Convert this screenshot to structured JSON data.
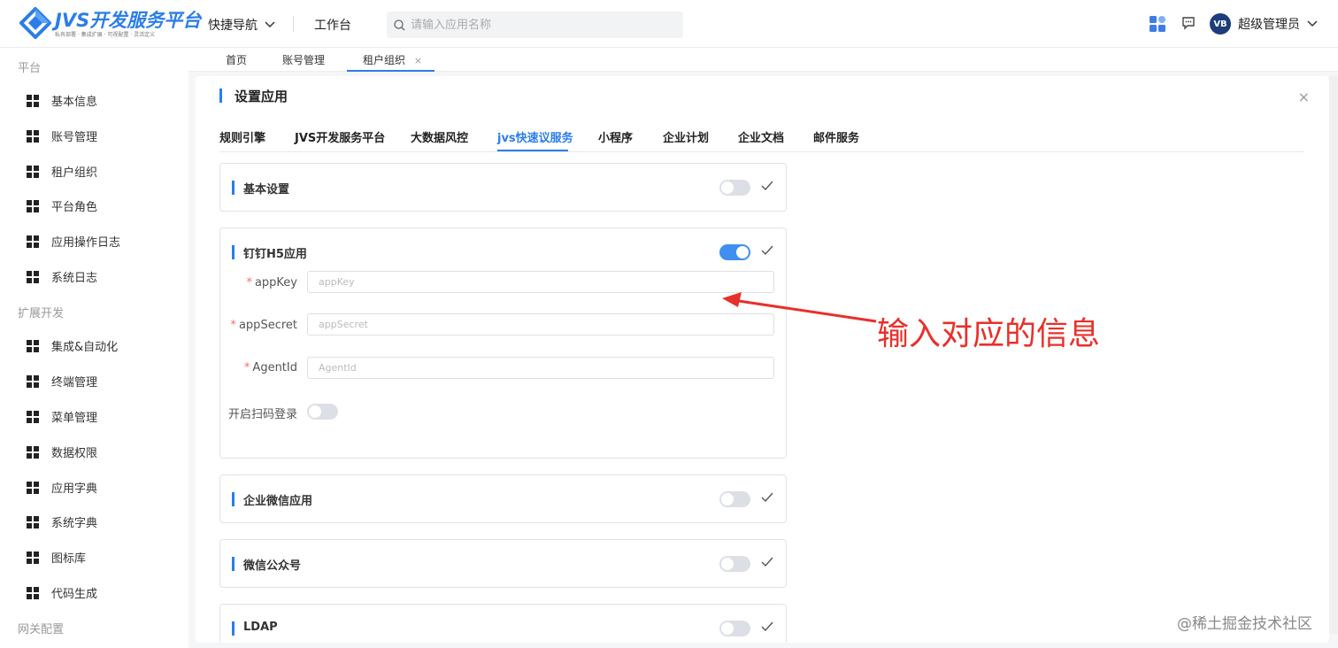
{
  "header": {
    "logo_title": "JVS开发服务平台",
    "logo_subtitle": "私有部署 · 集成扩展 · 可视配置 · 灵活定义",
    "quick_nav": "快捷导航",
    "workbench": "工作台",
    "search_placeholder": "请输入应用名称",
    "avatar_text": "VB",
    "user_name": "超级管理员"
  },
  "sidebar": {
    "group_platform": "平台",
    "group_extend": "扩展开发",
    "group_gateway": "网关配置",
    "items": [
      {
        "label": "基本信息"
      },
      {
        "label": "账号管理"
      },
      {
        "label": "租户组织"
      },
      {
        "label": "平台角色"
      },
      {
        "label": "应用操作日志"
      },
      {
        "label": "系统日志"
      },
      {
        "label": "集成&自动化"
      },
      {
        "label": "终端管理"
      },
      {
        "label": "菜单管理"
      },
      {
        "label": "数据权限"
      },
      {
        "label": "应用字典"
      },
      {
        "label": "系统字典"
      },
      {
        "label": "图标库"
      },
      {
        "label": "代码生成"
      }
    ]
  },
  "page_tabs": {
    "home": "首页",
    "account": "账号管理",
    "tenant": "租户组织",
    "close_glyph": "×"
  },
  "panel": {
    "title": "设置应用",
    "close_glyph": "×",
    "tabs": [
      "规则引擎",
      "JVS开发服务平台",
      "大数据风控",
      "jvs快速议服务",
      "小程序",
      "企业计划",
      "企业文档",
      "邮件服务"
    ],
    "active_tab": "jvs快速议服务"
  },
  "cards": {
    "basic": {
      "title": "基本设置",
      "enabled": false
    },
    "dingtalk": {
      "title": "钉钉H5应用",
      "enabled": true,
      "fields": [
        {
          "label": "appKey",
          "placeholder": "appKey",
          "required": "*"
        },
        {
          "label": "appSecret",
          "placeholder": "appSecret",
          "required": "*"
        },
        {
          "label": "AgentId",
          "placeholder": "AgentId",
          "required": "*"
        }
      ],
      "scan_login_label": "开启扫码登录",
      "scan_login_enabled": false
    },
    "wecom": {
      "title": "企业微信应用",
      "enabled": false
    },
    "wechat_mp": {
      "title": "微信公众号",
      "enabled": false
    },
    "ldap": {
      "title": "LDAP",
      "enabled": false
    }
  },
  "annotation": {
    "text": "输入对应的信息",
    "color": "#e8302a"
  },
  "watermark": "@稀土掘金技术社区",
  "colors": {
    "accent": "#2b7de9",
    "toggle_on": "#3f8ff0",
    "toggle_off": "#dcdfe6",
    "required": "#f56c6c"
  }
}
